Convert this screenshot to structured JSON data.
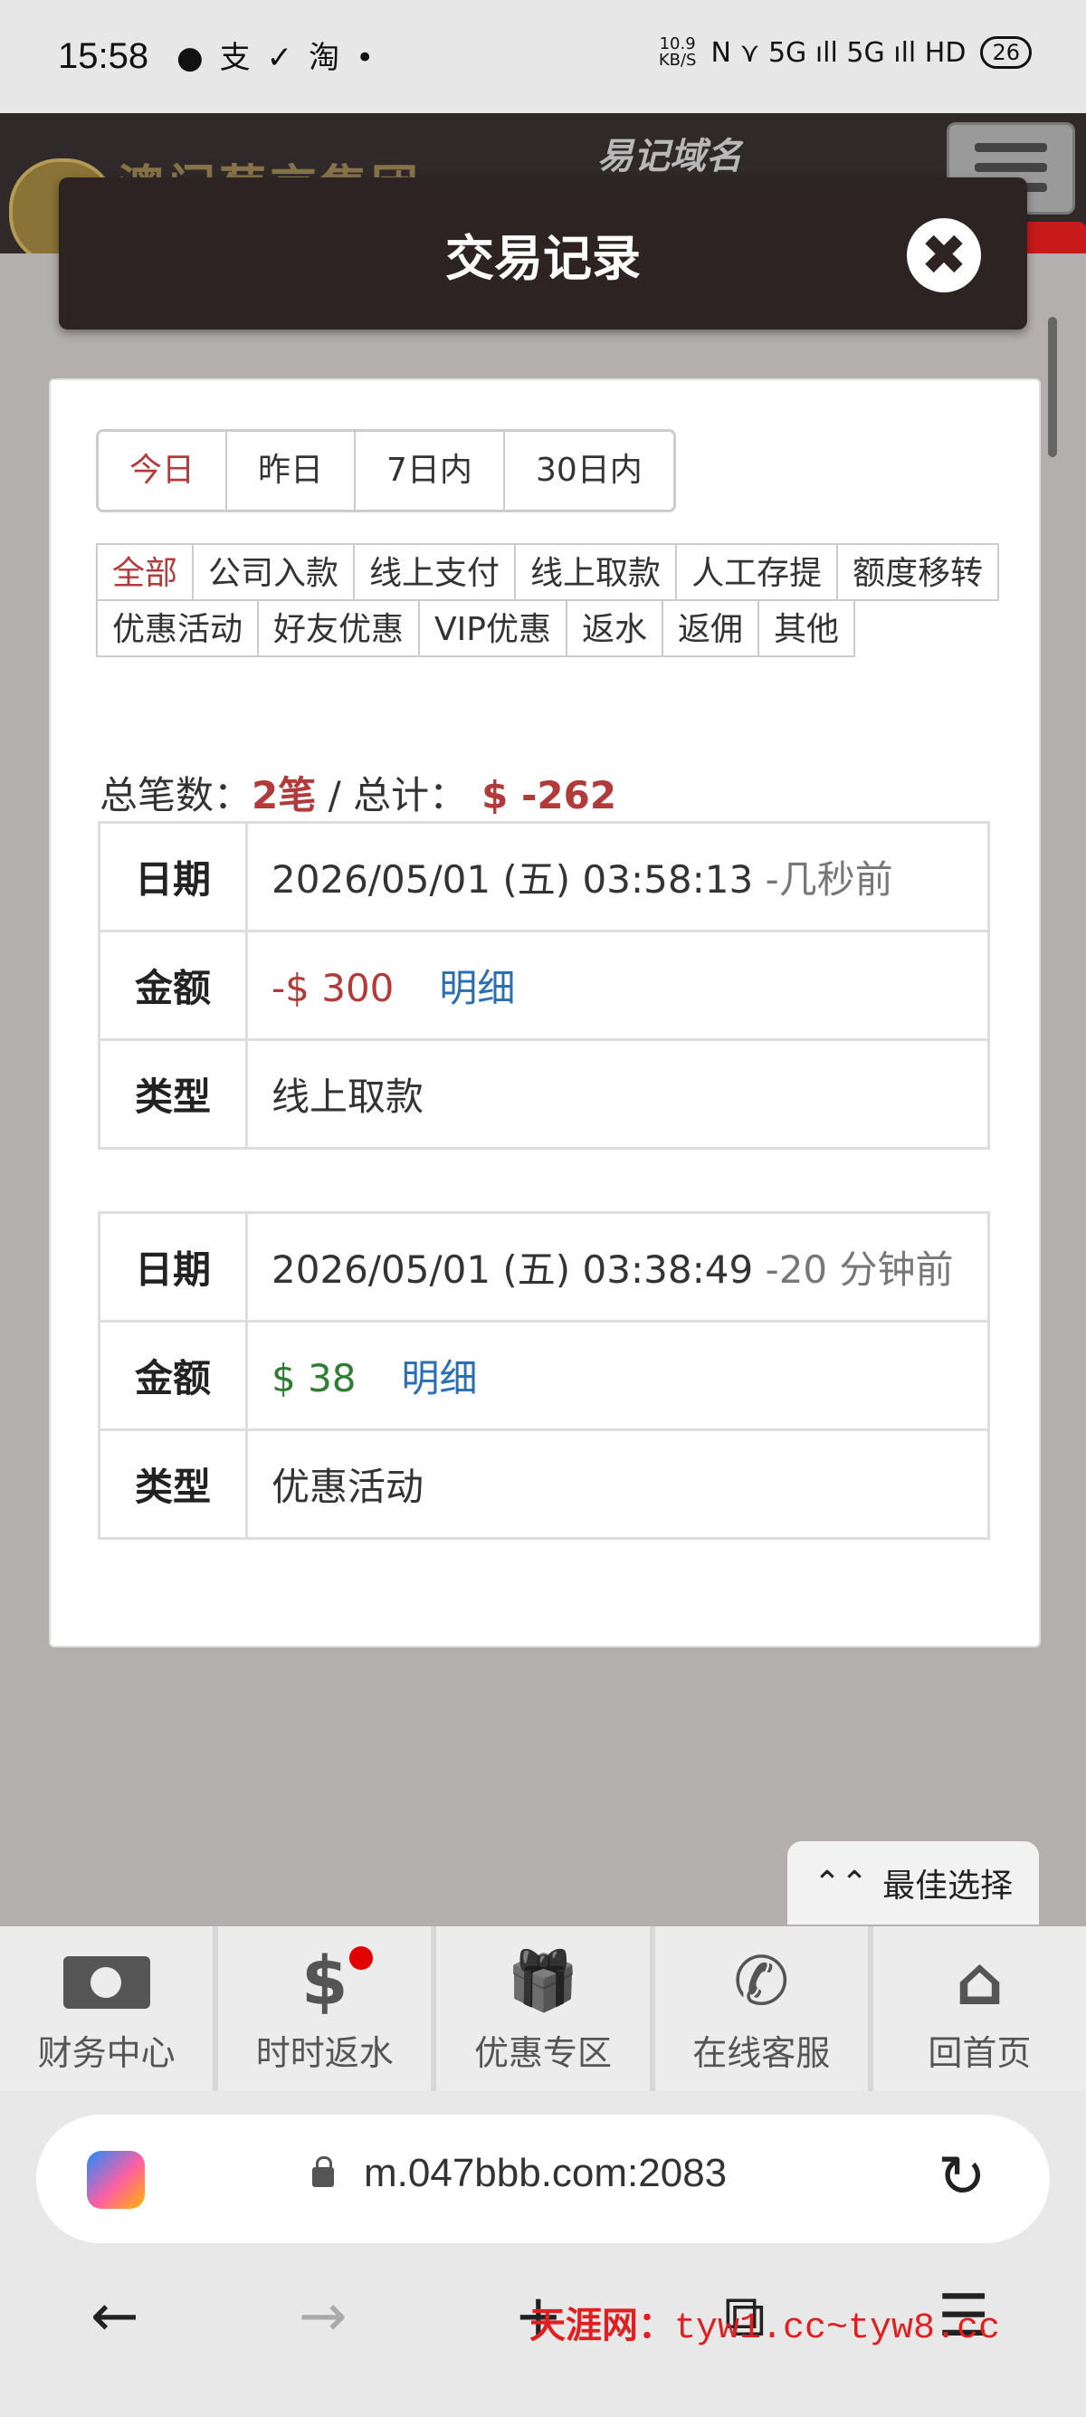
{
  "status_bar": {
    "time": "15:58",
    "notif_icons": [
      "●",
      "支",
      "✓",
      "淘",
      "•"
    ],
    "net_speed_top": "10.9",
    "net_speed_bottom": "KB/S",
    "signal": "N ⋎ 5G ıll 5G ıll HD",
    "battery": "26"
  },
  "site_header": {
    "brand": "澳门葡京集团",
    "domain_note": "易记域名"
  },
  "modal": {
    "title": "交易记录",
    "close_icon": "✖"
  },
  "period_tabs": [
    {
      "label": "今日",
      "active": true
    },
    {
      "label": "昨日",
      "active": false
    },
    {
      "label": "7日内",
      "active": false
    },
    {
      "label": "30日内",
      "active": false
    }
  ],
  "categories": [
    {
      "label": "全部",
      "active": true
    },
    {
      "label": "公司入款"
    },
    {
      "label": "线上支付"
    },
    {
      "label": "线上取款"
    },
    {
      "label": "人工存提"
    },
    {
      "label": "额度移转"
    },
    {
      "label": "优惠活动"
    },
    {
      "label": "好友优惠"
    },
    {
      "label": "VIP优惠"
    },
    {
      "label": "返水"
    },
    {
      "label": "返佣"
    },
    {
      "label": "其他"
    }
  ],
  "summary": {
    "count_label": "总笔数：",
    "count": "2笔",
    "separator": " / ",
    "total_label": "总计：",
    "total": "$ -262"
  },
  "records": [
    {
      "date_label": "日期",
      "date": "2026/05/01 (五) 03:58:13",
      "ago": "-几秒前",
      "amount_label": "金额",
      "amount": "-$ 300",
      "amount_type": "neg",
      "detail_link": "明细",
      "type_label": "类型",
      "type": "线上取款"
    },
    {
      "date_label": "日期",
      "date": "2026/05/01 (五) 03:38:49",
      "ago": "-20 分钟前",
      "amount_label": "金额",
      "amount": "$ 38",
      "amount_type": "pos",
      "detail_link": "明细",
      "type_label": "类型",
      "type": "优惠活动"
    }
  ],
  "best_choice": {
    "icon": "⌃⌃",
    "label": "最佳选择"
  },
  "bottom_nav": [
    {
      "label": "财务中心",
      "icon": "money-icon"
    },
    {
      "label": "时时返水",
      "icon": "dollar-icon",
      "glyph": "$",
      "badge": true
    },
    {
      "label": "优惠专区",
      "icon": "gift-icon",
      "glyph": "🎁"
    },
    {
      "label": "在线客服",
      "icon": "whatsapp-icon",
      "glyph": "✆"
    },
    {
      "label": "回首页",
      "icon": "home-icon",
      "glyph": "⌂"
    }
  ],
  "browser": {
    "url": "m.047bbb.com:2083",
    "reload_icon": "↻",
    "back": "←",
    "forward": "→",
    "new_tab": "+",
    "tabs": "⧉",
    "menu": "☰"
  },
  "watermark": {
    "text": "天涯网：",
    "url": "tyw1.cc~tyw8.cc"
  }
}
